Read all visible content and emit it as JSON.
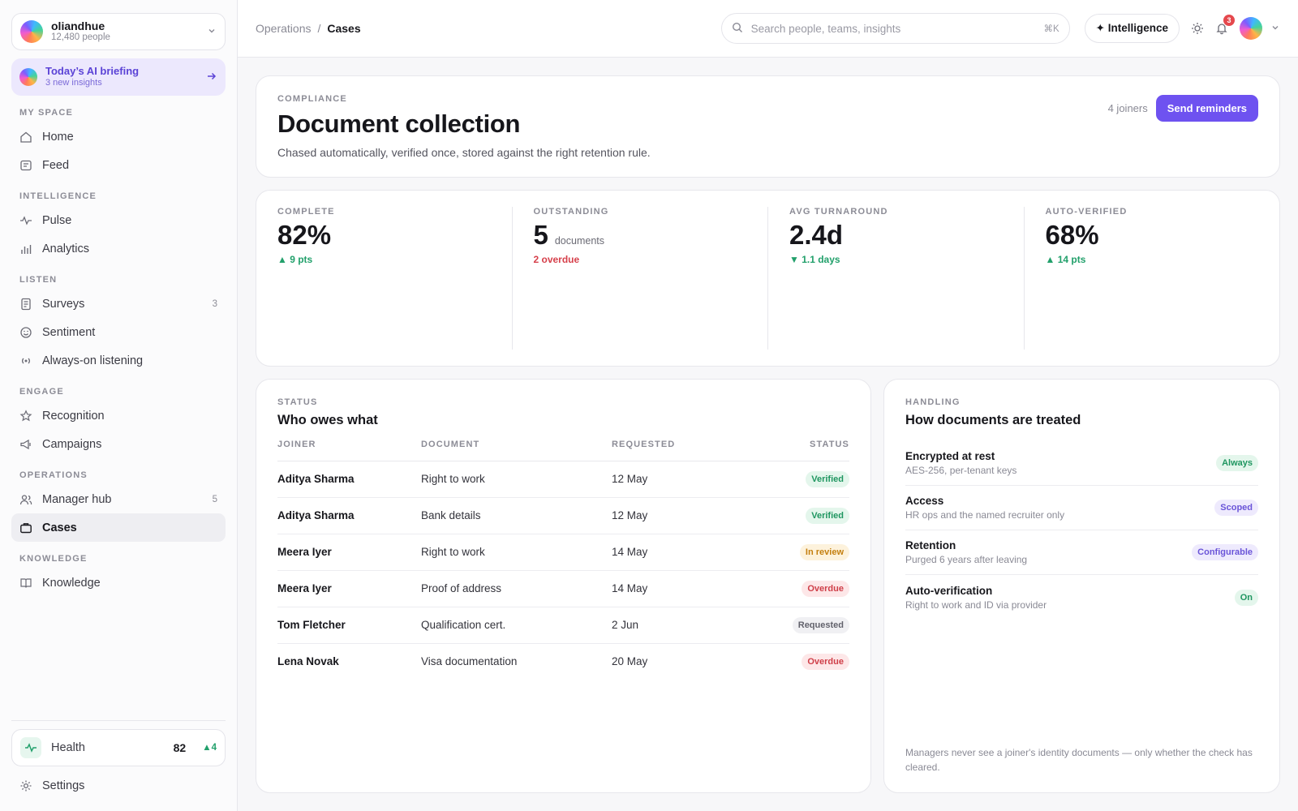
{
  "org": {
    "name": "oliandhue",
    "people": "12,480 people"
  },
  "briefing": {
    "title": "Today’s AI briefing",
    "sub": "3 new insights"
  },
  "nav": {
    "sections": [
      {
        "head": "MY SPACE",
        "items": [
          {
            "label": "Home",
            "icon": "home-icon"
          },
          {
            "label": "Feed",
            "icon": "feed-icon"
          }
        ]
      },
      {
        "head": "INTELLIGENCE",
        "items": [
          {
            "label": "Pulse",
            "icon": "pulse-icon"
          },
          {
            "label": "Analytics",
            "icon": "bar-chart-icon"
          }
        ]
      },
      {
        "head": "LISTEN",
        "items": [
          {
            "label": "Surveys",
            "icon": "survey-icon",
            "count": "3"
          },
          {
            "label": "Sentiment",
            "icon": "smile-icon"
          },
          {
            "label": "Always-on listening",
            "icon": "broadcast-icon"
          }
        ]
      },
      {
        "head": "ENGAGE",
        "items": [
          {
            "label": "Recognition",
            "icon": "star-icon"
          },
          {
            "label": "Campaigns",
            "icon": "megaphone-icon"
          }
        ]
      },
      {
        "head": "OPERATIONS",
        "items": [
          {
            "label": "Manager hub",
            "icon": "users-icon",
            "count": "5"
          },
          {
            "label": "Cases",
            "icon": "briefcase-icon",
            "active": true
          }
        ]
      },
      {
        "head": "KNOWLEDGE",
        "items": [
          {
            "label": "Knowledge",
            "icon": "book-icon"
          }
        ]
      }
    ]
  },
  "health": {
    "label": "Health",
    "score": "82",
    "delta": "▲4"
  },
  "settings": {
    "label": "Settings"
  },
  "topbar": {
    "crumb_parent": "Operations",
    "crumb_sep": "/",
    "crumb_current": "Cases",
    "search_placeholder": "Search people, teams, insights",
    "search_kbd": "⌘K",
    "intelligence_label": "✦ Intelligence",
    "notification_count": "3"
  },
  "hero": {
    "eyebrow": "COMPLIANCE",
    "title": "Document collection",
    "desc": "Chased automatically, verified once, stored against the right retention rule.",
    "joiners": "4 joiners",
    "action": "Send reminders"
  },
  "stats": [
    {
      "label": "COMPLETE",
      "value": "82%",
      "unit": "",
      "delta": "▲ 9 pts",
      "tone": "up"
    },
    {
      "label": "OUTSTANDING",
      "value": "5",
      "unit": "documents",
      "delta": "2 overdue",
      "tone": "bad"
    },
    {
      "label": "AVG TURNAROUND",
      "value": "2.4d",
      "unit": "",
      "delta": "▼ 1.1 days",
      "tone": "down"
    },
    {
      "label": "AUTO-VERIFIED",
      "value": "68%",
      "unit": "",
      "delta": "▲ 14 pts",
      "tone": "up"
    }
  ],
  "status_table": {
    "eyebrow": "STATUS",
    "title": "Who owes what",
    "columns": [
      "JOINER",
      "DOCUMENT",
      "REQUESTED",
      "STATUS"
    ],
    "rows": [
      {
        "joiner": "Aditya Sharma",
        "document": "Right to work",
        "requested": "12 May",
        "status": "Verified",
        "tone": "green"
      },
      {
        "joiner": "Aditya Sharma",
        "document": "Bank details",
        "requested": "12 May",
        "status": "Verified",
        "tone": "green"
      },
      {
        "joiner": "Meera Iyer",
        "document": "Right to work",
        "requested": "14 May",
        "status": "In review",
        "tone": "amber"
      },
      {
        "joiner": "Meera Iyer",
        "document": "Proof of address",
        "requested": "14 May",
        "status": "Overdue",
        "tone": "red"
      },
      {
        "joiner": "Tom Fletcher",
        "document": "Qualification cert.",
        "requested": "2 Jun",
        "status": "Requested",
        "tone": "grey"
      },
      {
        "joiner": "Lena Novak",
        "document": "Visa documentation",
        "requested": "20 May",
        "status": "Overdue",
        "tone": "red"
      }
    ]
  },
  "handling": {
    "eyebrow": "HANDLING",
    "title": "How documents are treated",
    "rows": [
      {
        "title": "Encrypted at rest",
        "sub": "AES-256, per-tenant keys",
        "tag": "Always",
        "tone": "green"
      },
      {
        "title": "Access",
        "sub": "HR ops and the named recruiter only",
        "tag": "Scoped",
        "tone": "purple"
      },
      {
        "title": "Retention",
        "sub": "Purged 6 years after leaving",
        "tag": "Configurable",
        "tone": "purple"
      },
      {
        "title": "Auto-verification",
        "sub": "Right to work and ID via provider",
        "tag": "On",
        "tone": "green"
      }
    ],
    "note": "Managers never see a joiner's identity documents — only whether the check has cleared."
  },
  "colors": {
    "accent": "#6e52f0",
    "success": "#22a06b",
    "danger": "#d6404b"
  }
}
